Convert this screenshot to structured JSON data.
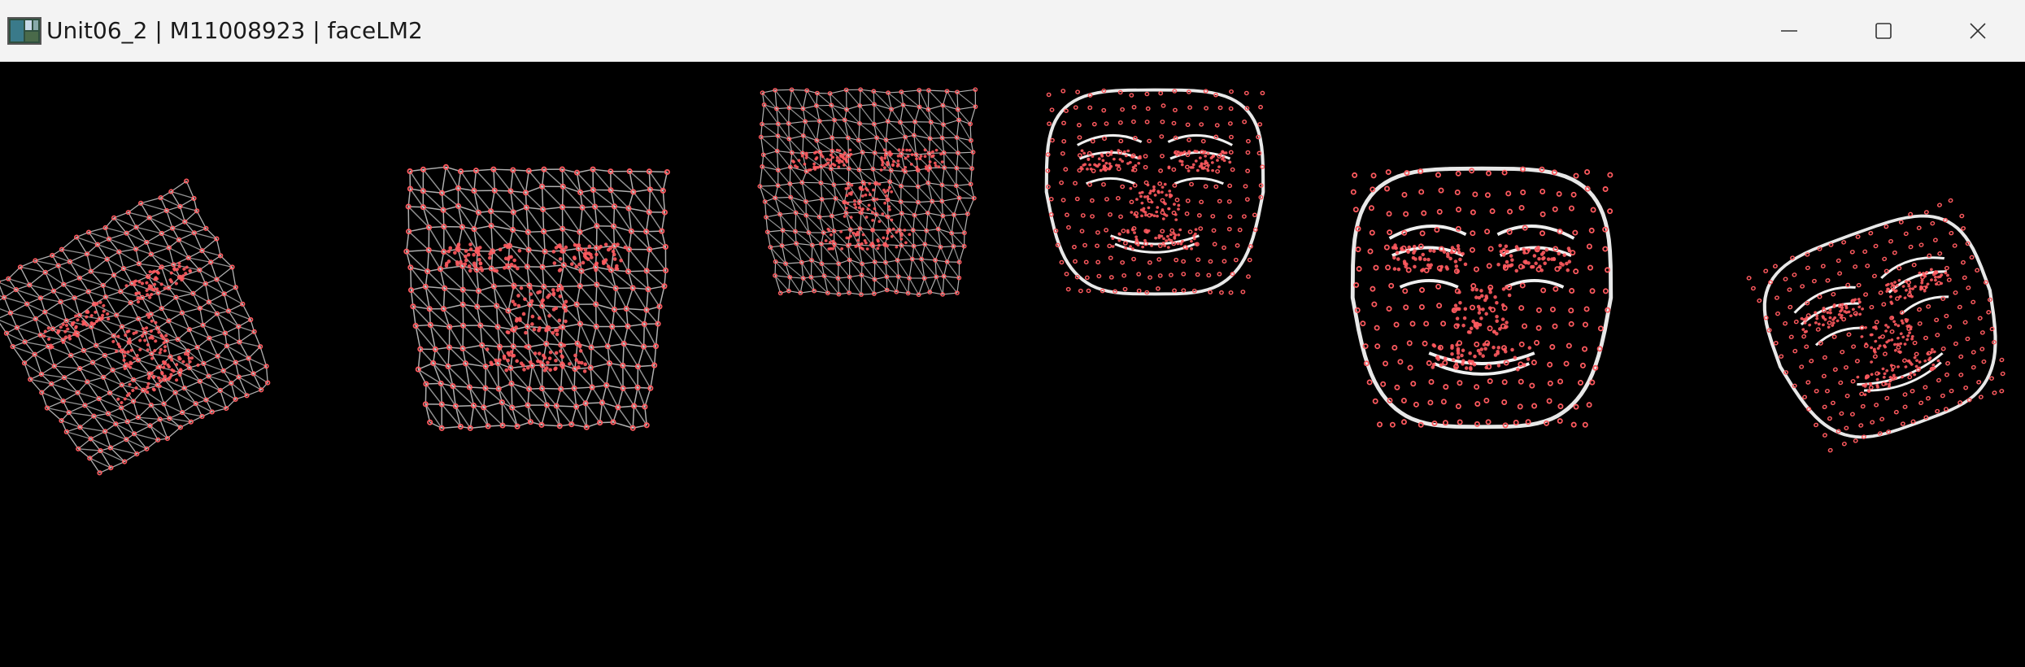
{
  "window": {
    "title": "Unit06_2 | M11008923 | faceLM2",
    "app_icon": "app-thumbnail-icon"
  },
  "controls": {
    "minimize_icon": "minimize-icon",
    "maximize_icon": "maximize-icon",
    "close_icon": "close-icon"
  },
  "canvas": {
    "background_color": "#000000",
    "landmark_color": "#ff5a5f",
    "mesh_color": "#cfcfcf",
    "faces": [
      {
        "style": "mesh",
        "tilt": "rotated-left"
      },
      {
        "style": "mesh",
        "tilt": "frontal"
      },
      {
        "style": "mesh",
        "tilt": "frontal"
      },
      {
        "style": "contour",
        "tilt": "frontal"
      },
      {
        "style": "contour",
        "tilt": "frontal"
      },
      {
        "style": "contour",
        "tilt": "rotated-right"
      }
    ]
  }
}
